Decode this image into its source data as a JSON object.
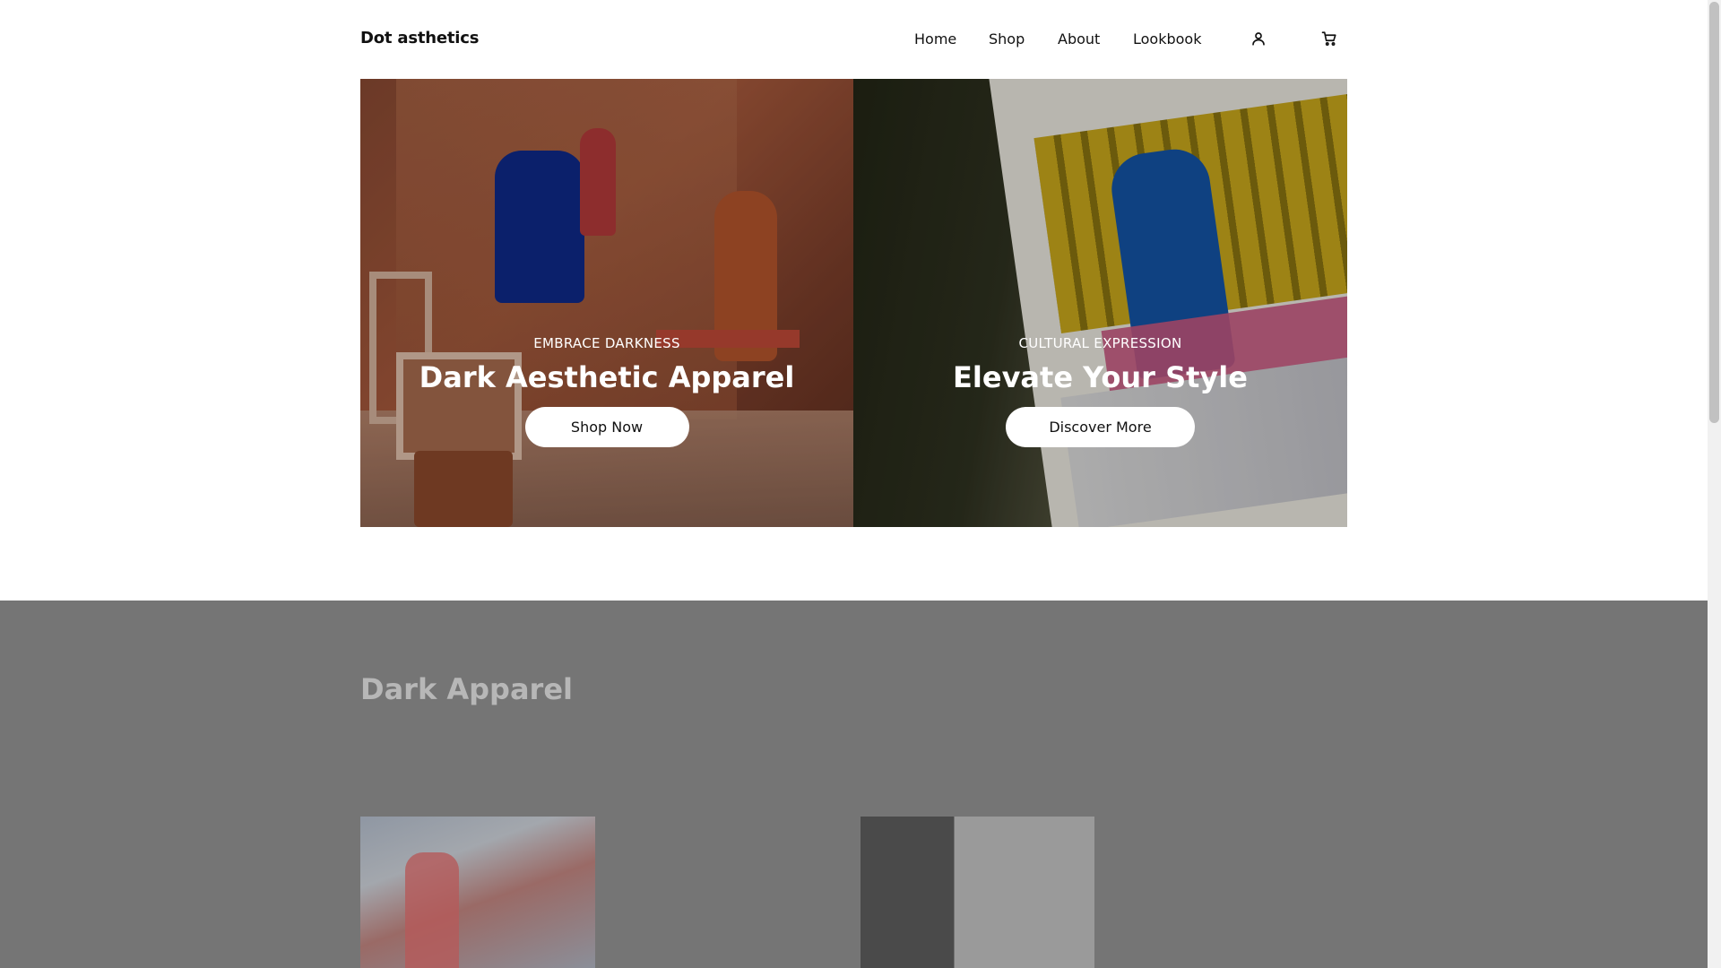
{
  "header": {
    "brand": "Dot asthetics",
    "nav": [
      "Home",
      "Shop",
      "About",
      "Lookbook"
    ],
    "icons": [
      "user-icon",
      "cart-icon"
    ]
  },
  "hero": {
    "left": {
      "eyebrow": "EMBRACE DARKNESS",
      "headline": "Dark Aesthetic Apparel",
      "cta": "Shop Now"
    },
    "right": {
      "eyebrow": "CULTURAL EXPRESSION",
      "headline": "Elevate Your Style",
      "cta": "Discover More"
    }
  },
  "section": {
    "title": "Dark Apparel"
  },
  "colors": {
    "section_bg": "#757575",
    "section_title": "#b7b7b7",
    "button_bg": "#ffffff"
  }
}
